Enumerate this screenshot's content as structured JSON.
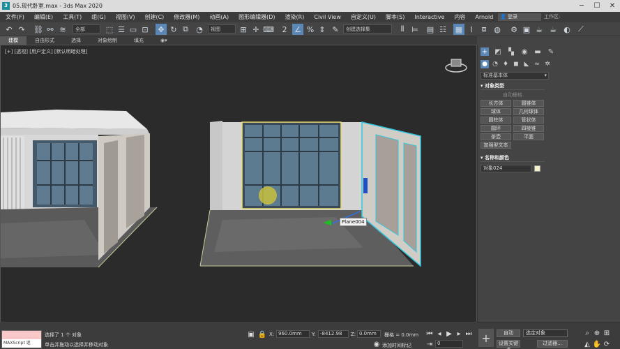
{
  "title": "05.现代卧室.max - 3ds Max 2020",
  "menu": [
    "文件(F)",
    "编辑(E)",
    "工具(T)",
    "组(G)",
    "视图(V)",
    "创建(C)",
    "修改器(M)",
    "动画(A)",
    "图形编辑器(D)",
    "渲染(R)",
    "Civil View",
    "自定义(U)",
    "脚本(S)",
    "Interactive",
    "内容",
    "Arnold"
  ],
  "login_label": "登录",
  "workspace_label": "工作区:",
  "toolbar": {
    "selection_filter": "全部",
    "ref_coord": "视图",
    "named_selection": "创建选择集"
  },
  "ribbon_tabs": [
    "建模",
    "自由形式",
    "选择",
    "对象绘制",
    "填充"
  ],
  "viewport": {
    "label": "[+] [透视] [用户定义] [默认明暗处理]",
    "tooltip": "Plane004"
  },
  "cmd": {
    "category": "标准基本体",
    "object_type_header": "对象类型",
    "autogrid": "自动栅格",
    "primitives": [
      "长方体",
      "圆锥体",
      "球体",
      "几何球体",
      "圆柱体",
      "管状体",
      "圆环",
      "四棱锥",
      "茶壶",
      "平面",
      "加强型文本"
    ],
    "name_color_header": "名称和颜色",
    "object_name": "对象024"
  },
  "status": {
    "maxscript": "MAXScript 迷",
    "selected": "选择了 1 个 对象",
    "hint": "单击并拖动以选择并移动对象",
    "x_label": "X:",
    "x_value": "960.0mm",
    "y_label": "Y:",
    "y_value": "-8412.98",
    "z_label": "Z:",
    "z_value": "0.0mm",
    "grid_label": "栅格 = 0.0mm",
    "add_time_tag": "添加时间标记",
    "auto_key": "自动",
    "set_key": "设置关键点",
    "selected_obj": "选定对象",
    "filters": "过滤器...",
    "frame": "0"
  }
}
